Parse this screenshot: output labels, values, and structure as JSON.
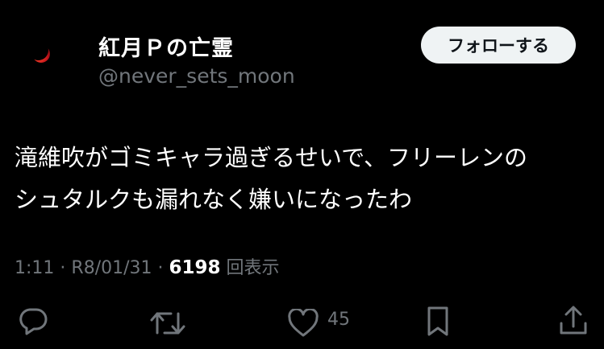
{
  "user": {
    "display_name": "紅月Ｐの亡霊",
    "handle": "@never_sets_moon"
  },
  "follow_label": "フォローする",
  "tweet": {
    "lines": [
      "滝維吹がゴミキャラ過ぎるせいで、フリーレンの",
      "シュタルクも漏れなく嫌いになったわ"
    ]
  },
  "meta": {
    "time": "1:11",
    "sep1": "·",
    "date": "R8/01/31",
    "sep2": "·",
    "views": "6198",
    "views_label": "回表示"
  },
  "actions": {
    "reply_icon": "reply-icon",
    "retweet_icon": "retweet-icon",
    "like_icon": "heart-icon",
    "like_count": "45",
    "bookmark_icon": "bookmark-icon",
    "share_icon": "share-icon"
  },
  "colors": {
    "background": "#000000",
    "text": "#ffffff",
    "muted": "#71767b",
    "button_bg": "#eff3f4",
    "moon": "#c3141b"
  }
}
